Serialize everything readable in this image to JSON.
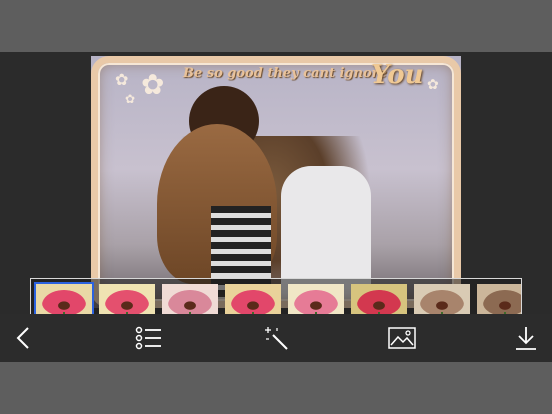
{
  "quote": {
    "text": "Be so good they cant ignore",
    "emphasis": "You"
  },
  "filters": [
    {
      "label": "None",
      "selected": true,
      "bg": "#e9d9a6",
      "petal": "#e2476a"
    },
    {
      "label": "Gorgeous",
      "selected": false,
      "bg": "#efe3b2",
      "petal": "#e4506e"
    },
    {
      "label": "Beauty",
      "selected": false,
      "bg": "#f0dbd5",
      "petal": "#d9889a"
    },
    {
      "label": "Transfer",
      "selected": false,
      "bg": "#e9d29a",
      "petal": "#e2476a"
    },
    {
      "label": "Process",
      "selected": false,
      "bg": "#f0e6c6",
      "petal": "#e67b96"
    },
    {
      "label": "Lomo",
      "selected": false,
      "bg": "#d7c47e",
      "petal": "#d3384f"
    },
    {
      "label": "Old Time",
      "selected": false,
      "bg": "#d9cbb4",
      "petal": "#a8846c"
    },
    {
      "label": "Moch",
      "selected": false,
      "bg": "#cbb69a",
      "petal": "#8c6a52"
    }
  ],
  "toolbar": {
    "icons": [
      "back-icon",
      "list-icon",
      "magic-wand-icon",
      "image-icon",
      "download-icon"
    ]
  },
  "colors": {
    "selection": "#2b62e0",
    "frame": "#e9c9a8"
  }
}
